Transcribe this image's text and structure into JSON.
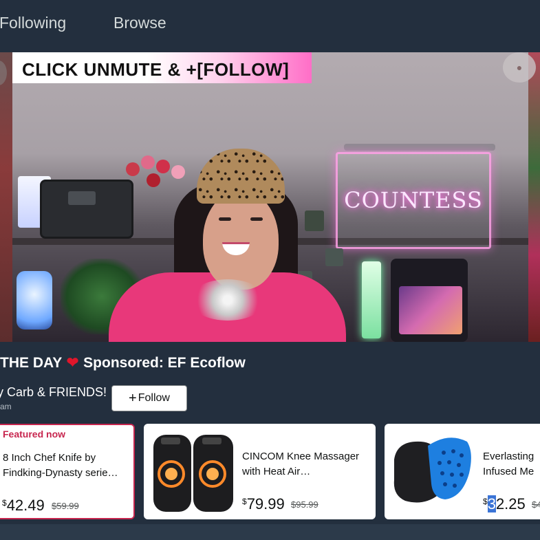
{
  "nav": {
    "tabs": [
      {
        "label": "Following"
      },
      {
        "label": "Browse"
      }
    ]
  },
  "video": {
    "banner": "CLICK UNMUTE & +[FOLLOW]",
    "sign_text": "COUNTESS"
  },
  "stream": {
    "title_prefix": "THE DAY",
    "title_suffix": "Sponsored: EF Ecoflow",
    "host": "y Carb & FRIENDS!",
    "host_sub": "am",
    "follow_label": "Follow"
  },
  "products": [
    {
      "badge": "Featured now",
      "title_line1": "8 Inch Chef Knife by",
      "title_line2": "Findking-Dynasty serie…",
      "currency": "$",
      "price": "42.49",
      "list_price": "$59.99"
    },
    {
      "title_line1": "CINCOM Knee Massager",
      "title_line2": "with Heat Air…",
      "currency": "$",
      "price": "79.99",
      "list_price": "$95.99"
    },
    {
      "title_line1": "Everlasting",
      "title_line2": "Infused Me",
      "currency": "$",
      "price_hl": "3",
      "price_rest": "2.25",
      "list_price": "$4"
    }
  ],
  "colors": {
    "background": "#232f3e",
    "featured": "#c7254e",
    "heart": "#e0162b",
    "selection": "#3b74d6"
  },
  "icons": {
    "heart": "heart-icon",
    "plus": "plus-icon"
  }
}
